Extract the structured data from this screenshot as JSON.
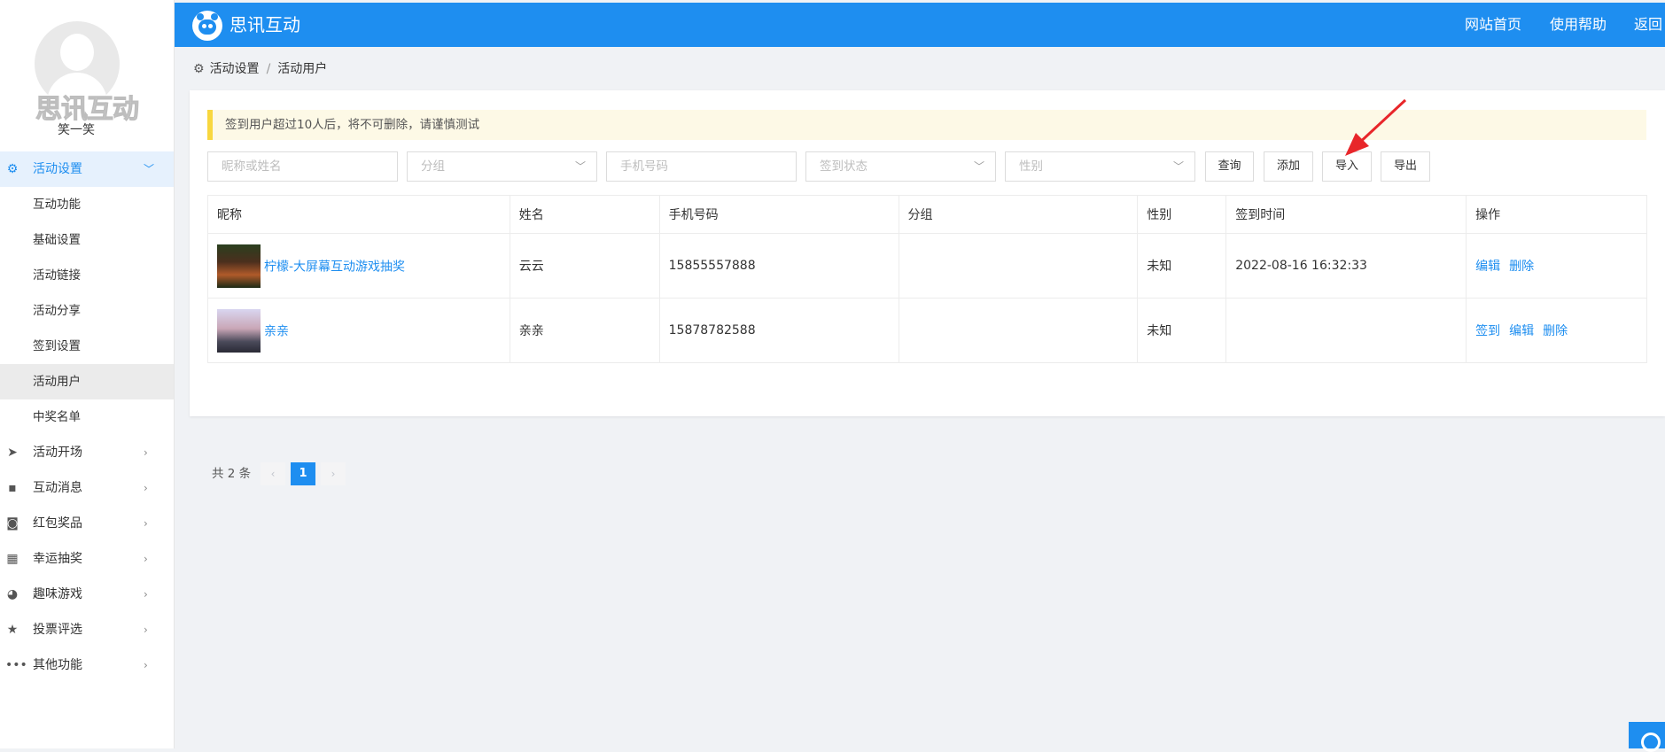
{
  "user": {
    "name": "笑一笑",
    "watermark": "思讯互动"
  },
  "brand": {
    "name": "思讯互动",
    "color": "#1e8ef0"
  },
  "top_nav": [
    {
      "label": "网站首页"
    },
    {
      "label": "使用帮助"
    },
    {
      "label": "返回"
    }
  ],
  "sidebar": {
    "open_group": {
      "label": "活动设置",
      "icon": "gears-icon"
    },
    "sub_items": [
      {
        "label": "互动功能"
      },
      {
        "label": "基础设置"
      },
      {
        "label": "活动链接"
      },
      {
        "label": "活动分享"
      },
      {
        "label": "签到设置"
      },
      {
        "label": "活动用户",
        "active": true
      },
      {
        "label": "中奖名单"
      }
    ],
    "groups": [
      {
        "label": "活动开场",
        "icon": "paper-plane-icon"
      },
      {
        "label": "互动消息",
        "icon": "chat-icon"
      },
      {
        "label": "红包奖品",
        "icon": "envelope-icon"
      },
      {
        "label": "幸运抽奖",
        "icon": "grid-icon"
      },
      {
        "label": "趣味游戏",
        "icon": "pacman-icon"
      },
      {
        "label": "投票评选",
        "icon": "star-icon"
      },
      {
        "label": "其他功能",
        "icon": "more-icon"
      }
    ]
  },
  "breadcrumb": {
    "parent": "活动设置",
    "separator": "/",
    "current": "活动用户"
  },
  "notice": "签到用户超过10人后，将不可删除，请谨慎测试",
  "filters": {
    "name_placeholder": "昵称或姓名",
    "group_placeholder": "分组",
    "phone_placeholder": "手机号码",
    "status_placeholder": "签到状态",
    "gender_placeholder": "性别"
  },
  "buttons": {
    "query": "查询",
    "add": "添加",
    "import": "导入",
    "export": "导出"
  },
  "table": {
    "headers": [
      "昵称",
      "姓名",
      "手机号码",
      "分组",
      "性别",
      "签到时间",
      "操作"
    ],
    "rows": [
      {
        "nickname": "柠檬-大屏幕互动游戏抽奖",
        "name": "云云",
        "phone": "15855557888",
        "group": "",
        "gender": "未知",
        "signin_time": "2022-08-16 16:32:33",
        "actions": [
          "编辑",
          "删除"
        ]
      },
      {
        "nickname": "亲亲",
        "name": "亲亲",
        "phone": "15878782588",
        "group": "",
        "gender": "未知",
        "signin_time": "",
        "actions": [
          "签到",
          "编辑",
          "删除"
        ]
      }
    ]
  },
  "pagination": {
    "total_label": "共 2 条",
    "current_page": "1",
    "prev": "‹",
    "next": "›"
  }
}
